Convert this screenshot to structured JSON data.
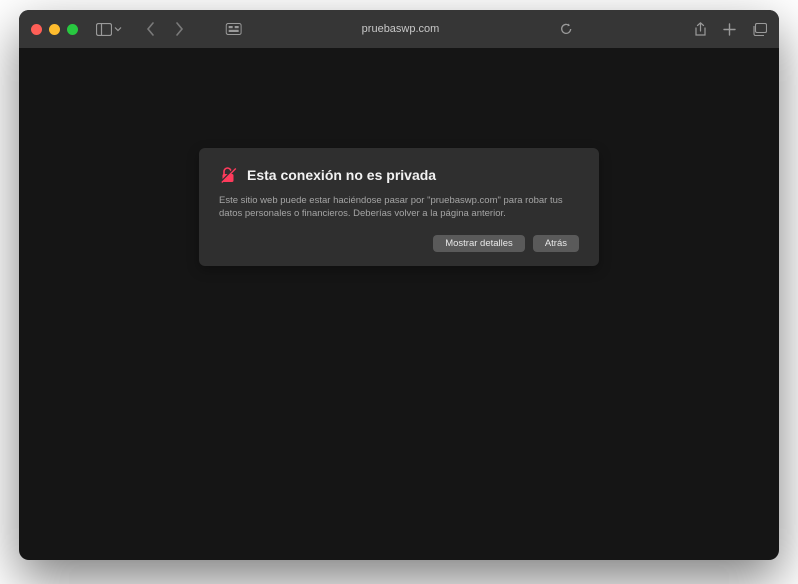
{
  "toolbar": {
    "url": "pruebaswp.com"
  },
  "warning": {
    "title": "Esta conexión no es privada",
    "body": "Este sitio web puede estar haciéndose pasar por \"pruebaswp.com\" para robar tus datos personales o financieros. Deberías volver a la página anterior.",
    "show_details_label": "Mostrar detalles",
    "back_label": "Atrás"
  }
}
